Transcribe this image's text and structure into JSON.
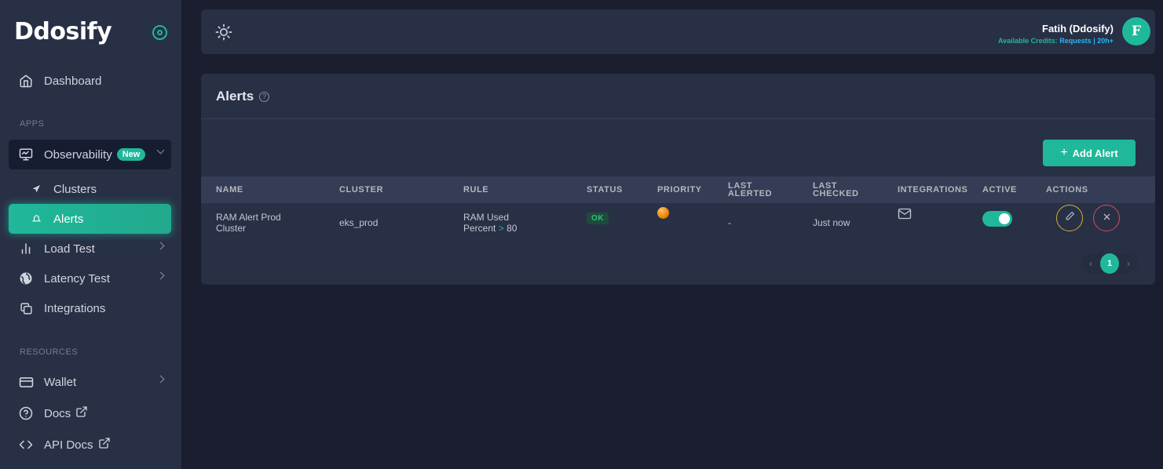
{
  "brand": {
    "name": "Ddosify"
  },
  "sidebar": {
    "dashboard": "Dashboard",
    "apps_label": "APPS",
    "observability": {
      "label": "Observability",
      "badge": "New"
    },
    "clusters": "Clusters",
    "alerts": "Alerts",
    "load_test": "Load Test",
    "latency_test": "Latency Test",
    "integrations": "Integrations",
    "resources_label": "RESOURCES",
    "wallet": "Wallet",
    "docs": "Docs",
    "api_docs": "API Docs"
  },
  "header": {
    "user_name": "Fatih (Ddosify)",
    "credits_label": "Available Credits:",
    "credits_value": "Requests | 20h+",
    "avatar_initial": "F"
  },
  "page": {
    "title": "Alerts",
    "add_button": "Add Alert"
  },
  "table": {
    "columns": {
      "name": "NAME",
      "cluster": "CLUSTER",
      "rule": "RULE",
      "status": "STATUS",
      "priority": "PRIORITY",
      "last_alerted_1": "LAST",
      "last_alerted_2": "ALERTED",
      "last_checked_1": "LAST",
      "last_checked_2": "CHECKED",
      "integrations": "INTEGRATIONS",
      "active": "ACTIVE",
      "actions": "ACTIONS"
    },
    "rows": [
      {
        "name_1": "RAM Alert Prod",
        "name_2": "Cluster",
        "cluster": "eks_prod",
        "rule_1": "RAM Used",
        "rule_2a": "Percent",
        "rule_op": ">",
        "rule_2b": "80",
        "status": "OK",
        "priority_color": "#f08c00",
        "last_alerted": "-",
        "last_checked": "Just now",
        "integration_icon": "mail-icon",
        "active": true
      }
    ]
  },
  "pagination": {
    "current": "1",
    "prev": "‹",
    "next": "›"
  },
  "colors": {
    "accent": "#1fb89a",
    "sidebar_bg": "#283046",
    "page_bg": "#1a1e2e",
    "credits_value": "#29b6f6"
  }
}
